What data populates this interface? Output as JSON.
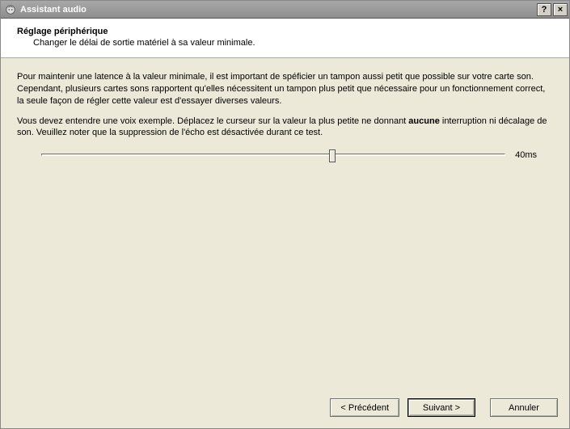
{
  "titlebar": {
    "title": "Assistant audio",
    "help": "?",
    "close": "×"
  },
  "header": {
    "title": "Réglage périphérique",
    "subtitle": "Changer le délai de sortie matériel à sa valeur minimale."
  },
  "content": {
    "para1": "Pour maintenir une latence à la valeur minimale, il est important de spéficier un tampon aussi petit que possible sur votre carte son. Cependant, plusieurs cartes sons rapportent qu'elles nécessitent un tampon plus petit que nécessaire pour un fonctionnement correct, la seule façon de régler cette valeur est d'essayer diverses valeurs.",
    "para2a": "Vous devez entendre une voix exemple. Déplacez le curseur sur la valeur la plus petite ne donnant ",
    "para2_bold": "aucune",
    "para2b": " interruption ni décalage de son. Veuillez noter que la suppression de l'écho est désactivée durant ce test."
  },
  "slider": {
    "value_label": "40ms",
    "thumb_percent": 62
  },
  "footer": {
    "back": "< Précédent",
    "next": "Suivant >",
    "cancel": "Annuler"
  }
}
